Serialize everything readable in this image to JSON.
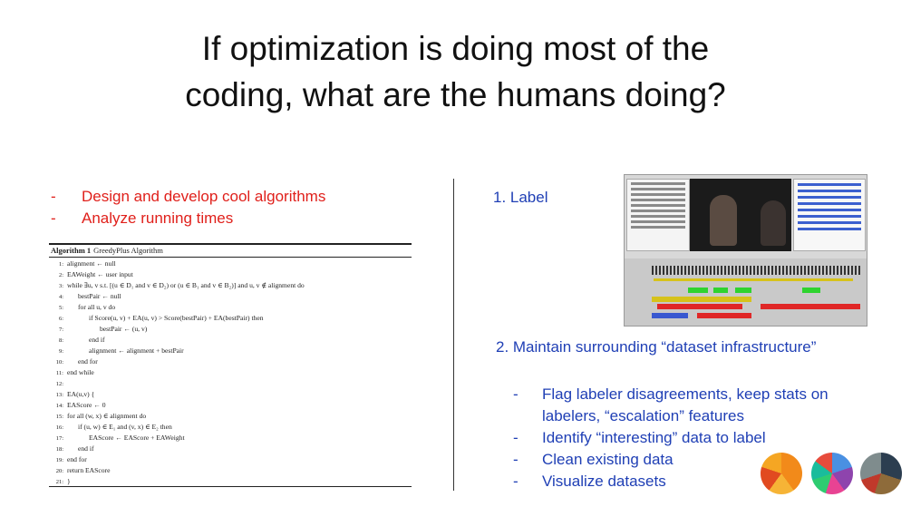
{
  "title": {
    "line1": "If optimization is doing most of the",
    "line2": "coding, what are the humans doing?"
  },
  "left": {
    "bullets": [
      "Design and develop cool algorithms",
      "Analyze running times"
    ],
    "algorithm": {
      "caption_label": "Algorithm 1",
      "caption_name": "GreedyPlus Algorithm",
      "lines": [
        {
          "n": "1:",
          "indent": 0,
          "text": "alignment ← null"
        },
        {
          "n": "2:",
          "indent": 0,
          "text": "EAWeight ← user input"
        },
        {
          "n": "3:",
          "indent": 0,
          "text": "while ∃u, v s.t. [(u ∈ D₁ and v ∈ D₂) or (u ∈ B₁ and v ∈ B₂)] and u, v ∉ alignment do"
        },
        {
          "n": "4:",
          "indent": 1,
          "text": "bestPair ← null"
        },
        {
          "n": "5:",
          "indent": 1,
          "text": "for all u, v do"
        },
        {
          "n": "6:",
          "indent": 2,
          "text": "if Score(u, v) + EA(u, v) > Score(bestPair) + EA(bestPair) then"
        },
        {
          "n": "7:",
          "indent": 3,
          "text": "bestPair ← (u, v)"
        },
        {
          "n": "8:",
          "indent": 2,
          "text": "end if"
        },
        {
          "n": "9:",
          "indent": 2,
          "text": "alignment ← alignment + bestPair"
        },
        {
          "n": "10:",
          "indent": 1,
          "text": "end for"
        },
        {
          "n": "11:",
          "indent": 0,
          "text": "end while"
        },
        {
          "n": "12:",
          "indent": 0,
          "text": ""
        },
        {
          "n": "13:",
          "indent": 0,
          "text": "EA(u,v) {"
        },
        {
          "n": "14:",
          "indent": 0,
          "text": "EAScore ← 0"
        },
        {
          "n": "15:",
          "indent": 0,
          "text": "for all (w, x) ∈ alignment do"
        },
        {
          "n": "16:",
          "indent": 1,
          "text": "if (u, w) ∈ E₁ and (v, x) ∈ E₂ then"
        },
        {
          "n": "17:",
          "indent": 2,
          "text": "EAScore ← EAScore + EAWeight"
        },
        {
          "n": "18:",
          "indent": 1,
          "text": "end if"
        },
        {
          "n": "19:",
          "indent": 0,
          "text": "end for"
        },
        {
          "n": "20:",
          "indent": 0,
          "text": "return EAScore"
        },
        {
          "n": "21:",
          "indent": 0,
          "text": "}"
        }
      ]
    }
  },
  "right": {
    "label1": "1. Label",
    "label2": "2. Maintain surrounding “dataset infrastructure”",
    "bullets": [
      "Flag labeler disagreements, keep stats on labelers, “escalation” features",
      "Identify “interesting” data to label",
      "Clean existing data",
      "Visualize datasets"
    ]
  },
  "colors": {
    "left_bullets": "#e0201b",
    "right_text": "#1f3fb5"
  }
}
